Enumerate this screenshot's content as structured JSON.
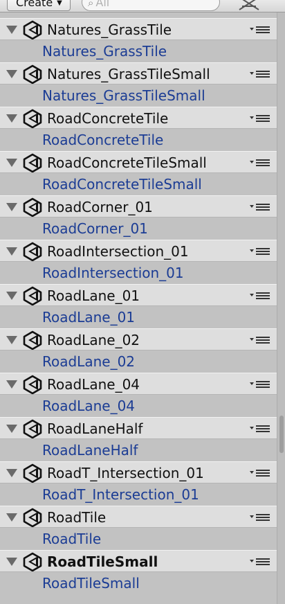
{
  "toolbar": {
    "create_label": "Create",
    "create_caret": "▼",
    "search_glass": "⌕",
    "search_placeholder": "All"
  },
  "components": [
    {
      "title": "Natures_GrassTile",
      "field": "Natures_GrassTile",
      "bold": false
    },
    {
      "title": "Natures_GrassTileSmall",
      "field": "Natures_GrassTileSmall",
      "bold": false
    },
    {
      "title": "RoadConcreteTile",
      "field": "RoadConcreteTile",
      "bold": false
    },
    {
      "title": "RoadConcreteTileSmall",
      "field": "RoadConcreteTileSmall",
      "bold": false
    },
    {
      "title": "RoadCorner_01",
      "field": "RoadCorner_01",
      "bold": false
    },
    {
      "title": "RoadIntersection_01",
      "field": "RoadIntersection_01",
      "bold": false
    },
    {
      "title": "RoadLane_01",
      "field": "RoadLane_01",
      "bold": false
    },
    {
      "title": "RoadLane_02",
      "field": "RoadLane_02",
      "bold": false
    },
    {
      "title": "RoadLane_04",
      "field": "RoadLane_04",
      "bold": false
    },
    {
      "title": "RoadLaneHalf",
      "field": "RoadLaneHalf",
      "bold": false
    },
    {
      "title": "RoadT_Intersection_01",
      "field": "RoadT_Intersection_01",
      "bold": false
    },
    {
      "title": "RoadTile",
      "field": "RoadTile",
      "bold": false
    },
    {
      "title": "RoadTileSmall",
      "field": "RoadTileSmall",
      "bold": true
    }
  ],
  "icons": {
    "object": "unity-icon",
    "foldout": "foldout-triangle-icon",
    "menu": "context-menu-icon",
    "tools": "tools-icon"
  },
  "colors": {
    "object_row_bg": "#dedede",
    "field_row_bg": "#c2c2c2",
    "field_text": "#1b3c94"
  }
}
